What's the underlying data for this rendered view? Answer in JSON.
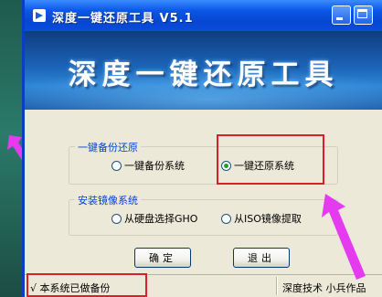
{
  "window": {
    "title": "深度一键还原工具 V5.1",
    "banner_title": "深度一键还原工具"
  },
  "backup_group": {
    "legend": "一键备份还原",
    "options": [
      {
        "label": "一键备份系统",
        "selected": false
      },
      {
        "label": "一键还原系统",
        "selected": true
      }
    ]
  },
  "image_group": {
    "legend": "安装镜像系统",
    "options": [
      {
        "label": "从硬盘选择GHO",
        "selected": false
      },
      {
        "label": "从ISO镜像提取",
        "selected": false
      }
    ]
  },
  "buttons": {
    "ok": "确定",
    "exit": "退出"
  },
  "statusbar": {
    "left": "√ 本系统已做备份",
    "right": "深度技术 小兵作品"
  },
  "colors": {
    "annotation_box": "#d8202a",
    "arrow": "#e53bf0",
    "radio_selected": "#21a121"
  },
  "icons": [
    "app-icon",
    "minimize-icon",
    "maximize-icon",
    "annotation-arrow"
  ]
}
